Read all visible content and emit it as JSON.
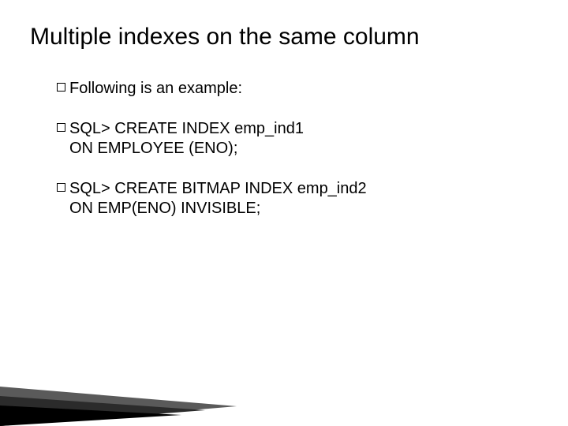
{
  "title": "Multiple indexes on the same column",
  "bullets": [
    {
      "line1": "Following is an example:",
      "line2": ""
    },
    {
      "line1": "SQL> CREATE INDEX emp_ind1",
      "line2": "ON EMPLOYEE (ENO);"
    },
    {
      "line1": "SQL> CREATE BITMAP INDEX emp_ind2",
      "line2": "ON EMP(ENO) INVISIBLE;"
    }
  ]
}
